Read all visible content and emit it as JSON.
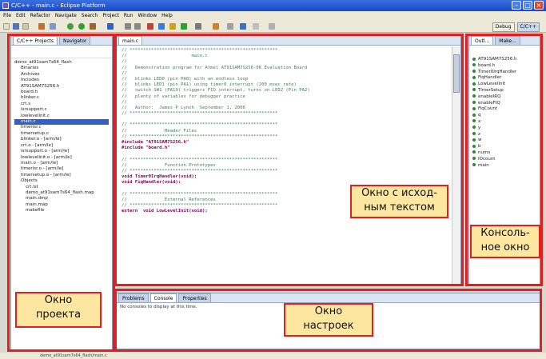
{
  "window": {
    "title": "C/C++ - main.c - Eclipse Platform"
  },
  "menu": [
    "File",
    "Edit",
    "Refactor",
    "Navigate",
    "Search",
    "Project",
    "Run",
    "Window",
    "Help"
  ],
  "perspectives": {
    "debug": "Debug",
    "cpp": "C/C++"
  },
  "project_panel": {
    "tabs": [
      "C/C++ Projects",
      "Navigator"
    ],
    "tree": [
      "demo_at91sam7s64_flash",
      "Binaries",
      "Archives",
      "Includes",
      "AT91SAM7S256.h",
      "board.h",
      "blinker.c",
      "crt.s",
      "isrsupport.c",
      "lowlevelinit.c",
      "main.c",
      "timerisr.c",
      "timersetup.c",
      "blinker.o - [arm/le]",
      "crt.o - [arm/le]",
      "isrsupport.o - [arm/le]",
      "lowlevelinit.o - [arm/le]",
      "main.o - [arm/le]",
      "timerisr.o - [arm/le]",
      "timersetup.o - [arm/le]",
      "Objects",
      "crt.lst",
      "demo_at91sam7s64_flash.map",
      "main.dmp",
      "main.map",
      "makefile"
    ],
    "selected_index": 10
  },
  "editor": {
    "tab": "main.c",
    "lines": [
      "// *******************************************************",
      "//                        main.c",
      "//",
      "//   Demonstration program for Atmel AT91SAM7S256-EK Evaluation Board",
      "//",
      "//   blinks LED0 (pin PA0) with an endless loop",
      "//   blinks LED1 (pin PA1) using timer0 interrupt (200 msec rate)",
      "//   switch SW1 (PA19) triggers FIQ interrupt, turns on LED2 (Pin PA2)",
      "//   plenty of variables for debugger practice",
      "//",
      "//   Author:  James P Lynch  September 1, 2006",
      "// *******************************************************",
      "",
      "// *******************************************************",
      "//              Header Files",
      "// *******************************************************",
      "#include \"AT91SAM7S256.h\"",
      "#include \"board.h\"",
      "",
      "// *******************************************************",
      "//              Function Prototypes",
      "// *******************************************************",
      "void Timer0IrqHandler(void);",
      "void FiqHandler(void);",
      "",
      "// *******************************************************",
      "//              External References",
      "// *******************************************************",
      "extern  void LowLevelInit(void);"
    ]
  },
  "outline_panel": {
    "tabs": [
      "Outl...",
      "Make..."
    ],
    "items": [
      "AT91SAM7S256.h",
      "board.h",
      "Timer0IrqHandler",
      "FiqHandler",
      "LowLevelInit",
      "TimerSetup",
      "enableIRQ",
      "enableFIQ",
      "FiqCount",
      "q",
      "x",
      "y",
      "z",
      "w",
      "b",
      "nums",
      "IOcount",
      "main"
    ]
  },
  "bottom_panel": {
    "tabs": [
      "Problems",
      "Console",
      "Properties"
    ],
    "message": "No consoles to display at this time."
  },
  "statusbar": {
    "text": "demo_at91sam7s64_flash/main.c"
  },
  "annotations": {
    "editor": [
      "Окно с исход-",
      "ным текстом"
    ],
    "outline": [
      "Консоль-",
      "ное окно"
    ],
    "project": [
      "Окно",
      "проекта"
    ],
    "settings": [
      "Окно",
      "настроек"
    ]
  }
}
